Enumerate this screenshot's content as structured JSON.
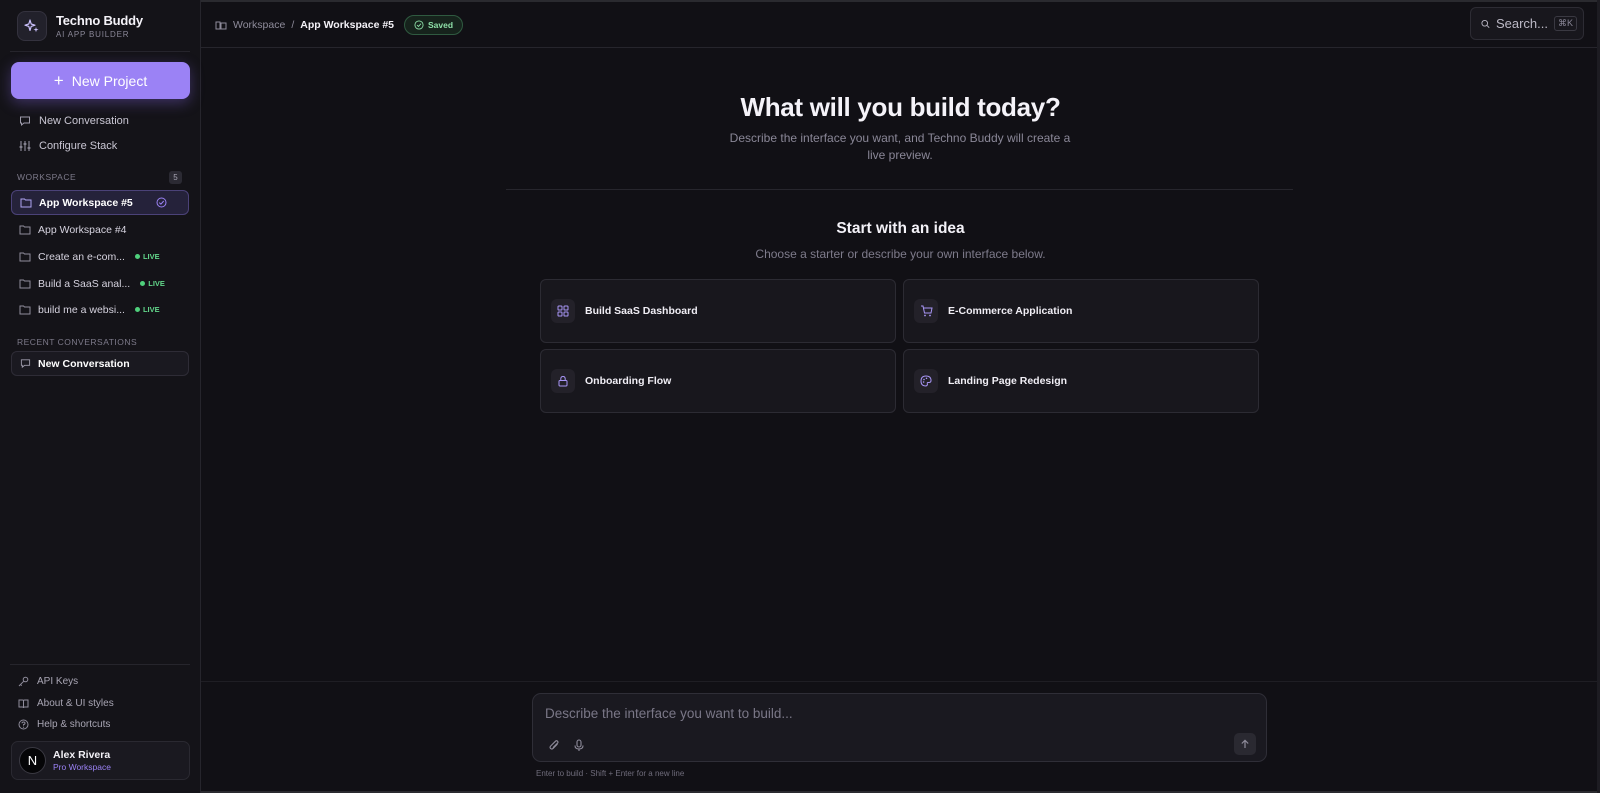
{
  "brand": {
    "name": "Techno Buddy",
    "subtitle": "AI APP BUILDER",
    "accent": "#9b82f5"
  },
  "sidebar": {
    "new_project_label": "New Project",
    "links": [
      {
        "label": "New Conversation",
        "icon": "chat-bubble-icon"
      },
      {
        "label": "Configure Stack",
        "icon": "sliders-icon"
      }
    ],
    "workspace_section": "WORKSPACE",
    "workspace_count": "5",
    "workspaces": [
      {
        "label": "App Workspace #5",
        "active": true,
        "status": ""
      },
      {
        "label": "App Workspace #4",
        "active": false,
        "status": ""
      },
      {
        "label": "Create an e-com...",
        "active": false,
        "status": "LIVE"
      },
      {
        "label": "Build a SaaS anal...",
        "active": false,
        "status": "LIVE"
      },
      {
        "label": "build me a websi...",
        "active": false,
        "status": "LIVE"
      }
    ],
    "recent_section": "RECENT CONVERSATIONS",
    "recent": [
      {
        "label": "New Conversation"
      }
    ],
    "bottom_links": [
      {
        "label": "API Keys",
        "icon": "key-icon"
      },
      {
        "label": "About & UI styles",
        "icon": "book-icon"
      },
      {
        "label": "Help & shortcuts",
        "icon": "help-circle-icon"
      }
    ],
    "user": {
      "initial": "N",
      "name": "Alex Rivera",
      "plan": "Pro Workspace"
    }
  },
  "topbar": {
    "breadcrumb_root": "Workspace",
    "breadcrumb_sep": "/",
    "breadcrumb_current": "App Workspace #5",
    "saved_label": "Saved",
    "search_placeholder": "Search...",
    "search_shortcut": "⌘K"
  },
  "main": {
    "title": "What will you build today?",
    "subtitle": "Describe the interface you want, and Techno Buddy will create a live preview.",
    "ideas_title": "Start with an idea",
    "ideas_subtitle": "Choose a starter or describe your own interface below.",
    "cards": [
      {
        "label": "Build SaaS Dashboard",
        "icon": "grid-icon"
      },
      {
        "label": "E-Commerce Application",
        "icon": "cart-icon"
      },
      {
        "label": "Onboarding Flow",
        "icon": "lock-icon"
      },
      {
        "label": "Landing Page Redesign",
        "icon": "palette-icon"
      }
    ]
  },
  "composer": {
    "placeholder": "Describe the interface you want to build...",
    "hint": "Enter to build · Shift + Enter for a new line"
  }
}
